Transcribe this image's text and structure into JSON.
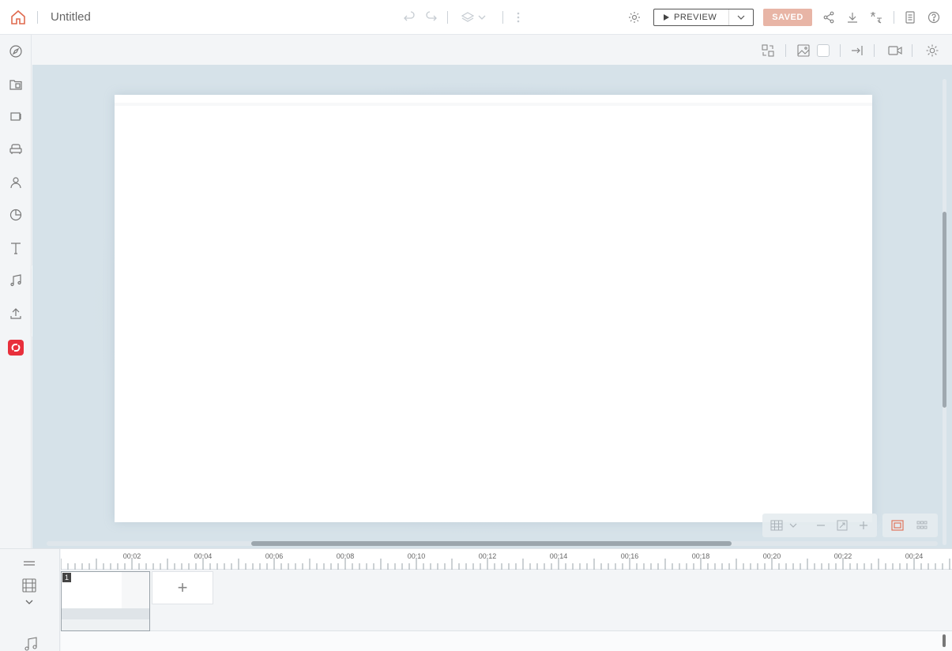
{
  "header": {
    "title": "Untitled",
    "preview_label": "PREVIEW",
    "saved_label": "SAVED"
  },
  "timeline": {
    "scene_number": "1",
    "add_scene_label": "+",
    "ticks": [
      "00:02",
      "00:04",
      "00:06",
      "00:08",
      "00:10",
      "00:12",
      "00:14",
      "00:16",
      "00:18",
      "00:20",
      "00:22",
      "00:24"
    ]
  },
  "colors": {
    "accent": "#e06a4f",
    "saved_bg": "#e8b5a6",
    "brand_red": "#e8303c",
    "stage_bg": "#d6e2e9"
  }
}
